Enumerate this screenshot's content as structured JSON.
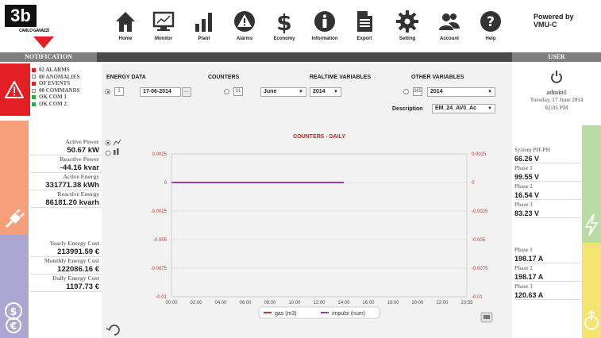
{
  "figure_label": "3b",
  "logo_text": "CARLO GAVAZZI",
  "nav": [
    {
      "label": "Home",
      "icon": "home-icon"
    },
    {
      "label": "Monitor",
      "icon": "monitor-icon"
    },
    {
      "label": "Plant",
      "icon": "plant-bar-chart-icon"
    },
    {
      "label": "Alarms",
      "icon": "alarm-warning-icon"
    },
    {
      "label": "Economy",
      "icon": "dollar-icon"
    },
    {
      "label": "Information",
      "icon": "info-icon"
    },
    {
      "label": "Export",
      "icon": "document-icon"
    },
    {
      "label": "Setting",
      "icon": "gear-icon"
    },
    {
      "label": "Account",
      "icon": "users-icon"
    },
    {
      "label": "Help",
      "icon": "help-icon"
    }
  ],
  "powered": {
    "line1": "Powered by",
    "line2": "VMU-C"
  },
  "bar": {
    "left": "NOTIFICATION",
    "right": "USER"
  },
  "notifications": [
    {
      "marker": "red",
      "text": "02  ALARMS"
    },
    {
      "marker": "empty",
      "text": "00  ANOMALIES"
    },
    {
      "marker": "red",
      "text": "OF  EVENTS"
    },
    {
      "marker": "empty",
      "text": "00  COMMANDS"
    },
    {
      "marker": "green",
      "text": "OK  COM 1"
    },
    {
      "marker": "green",
      "text": "OK  COM 2"
    }
  ],
  "power_values": [
    {
      "label": "Active Power",
      "value": "50.67 kW"
    },
    {
      "label": "Reactive Power",
      "value": "-44.16 kvar"
    },
    {
      "label": "Active Energy",
      "value": "331771.38 kWh"
    },
    {
      "label": "Reactive Energy",
      "value": "86181.20 kvarh"
    }
  ],
  "cost_values": [
    {
      "label": "Yearly Energy Cost",
      "value": "213991.59 €"
    },
    {
      "label": "Monthly Energy Cost",
      "value": "122086.16 €"
    },
    {
      "label": "Daily Energy Cost",
      "value": "1197.73 €"
    }
  ],
  "controls": {
    "energy_data": "ENERGY DATA",
    "counters": "COUNTERS",
    "realtime": "REALTIME VARIABLES",
    "other": "OTHER VARIABLES",
    "cal_day": "1",
    "cal_month": "31",
    "cal_year": "365",
    "date": "17-06-2014",
    "date_btn": "...",
    "month": "June",
    "year": "2014",
    "other_year": "2014",
    "description_label": "Description",
    "description": "EM_24_AV0_Ac"
  },
  "user": {
    "name": "admin1",
    "date": "Tuesday, 17 June 2014",
    "time": "02:05 PM"
  },
  "volt_values": [
    {
      "label": "System PH-PH",
      "value": "66.26 V"
    },
    {
      "label": "Phase 1",
      "value": "99.55 V"
    },
    {
      "label": "Phase 2",
      "value": "16.54 V"
    },
    {
      "label": "Phase 3",
      "value": "83.23 V"
    }
  ],
  "amp_values": [
    {
      "label": "Phase 1",
      "value": "198.17 A"
    },
    {
      "label": "Phase 2",
      "value": "198.17 A"
    },
    {
      "label": "Phase 3",
      "value": "120.63 A"
    }
  ],
  "colors": {
    "accent": "#e31e24",
    "series_gas": "#c0392b",
    "series_impulsi": "#8e44ad"
  },
  "chart_data": {
    "type": "line",
    "title": "COUNTERS - DAILY",
    "x": [
      "00:00",
      "02:00",
      "04:00",
      "06:00",
      "08:00",
      "10:00",
      "12:00",
      "14:00",
      "16:00",
      "18:00",
      "20:00",
      "22:00",
      "23:55"
    ],
    "yticks": [
      "0.0025",
      "0",
      "-0.0025",
      "-0.005",
      "-0.0075",
      "-0.01"
    ],
    "ylim": [
      -0.01,
      0.0025
    ],
    "series": [
      {
        "name": "gas (m3)",
        "values": [
          0,
          0,
          0,
          0,
          0,
          0,
          0,
          0,
          null,
          null,
          null,
          null,
          null
        ]
      },
      {
        "name": "impulsi (num)",
        "values": [
          0,
          0,
          0,
          0,
          0,
          0,
          0,
          0,
          null,
          null,
          null,
          null,
          null
        ]
      }
    ],
    "legend": "bottom-center",
    "grid": true
  }
}
